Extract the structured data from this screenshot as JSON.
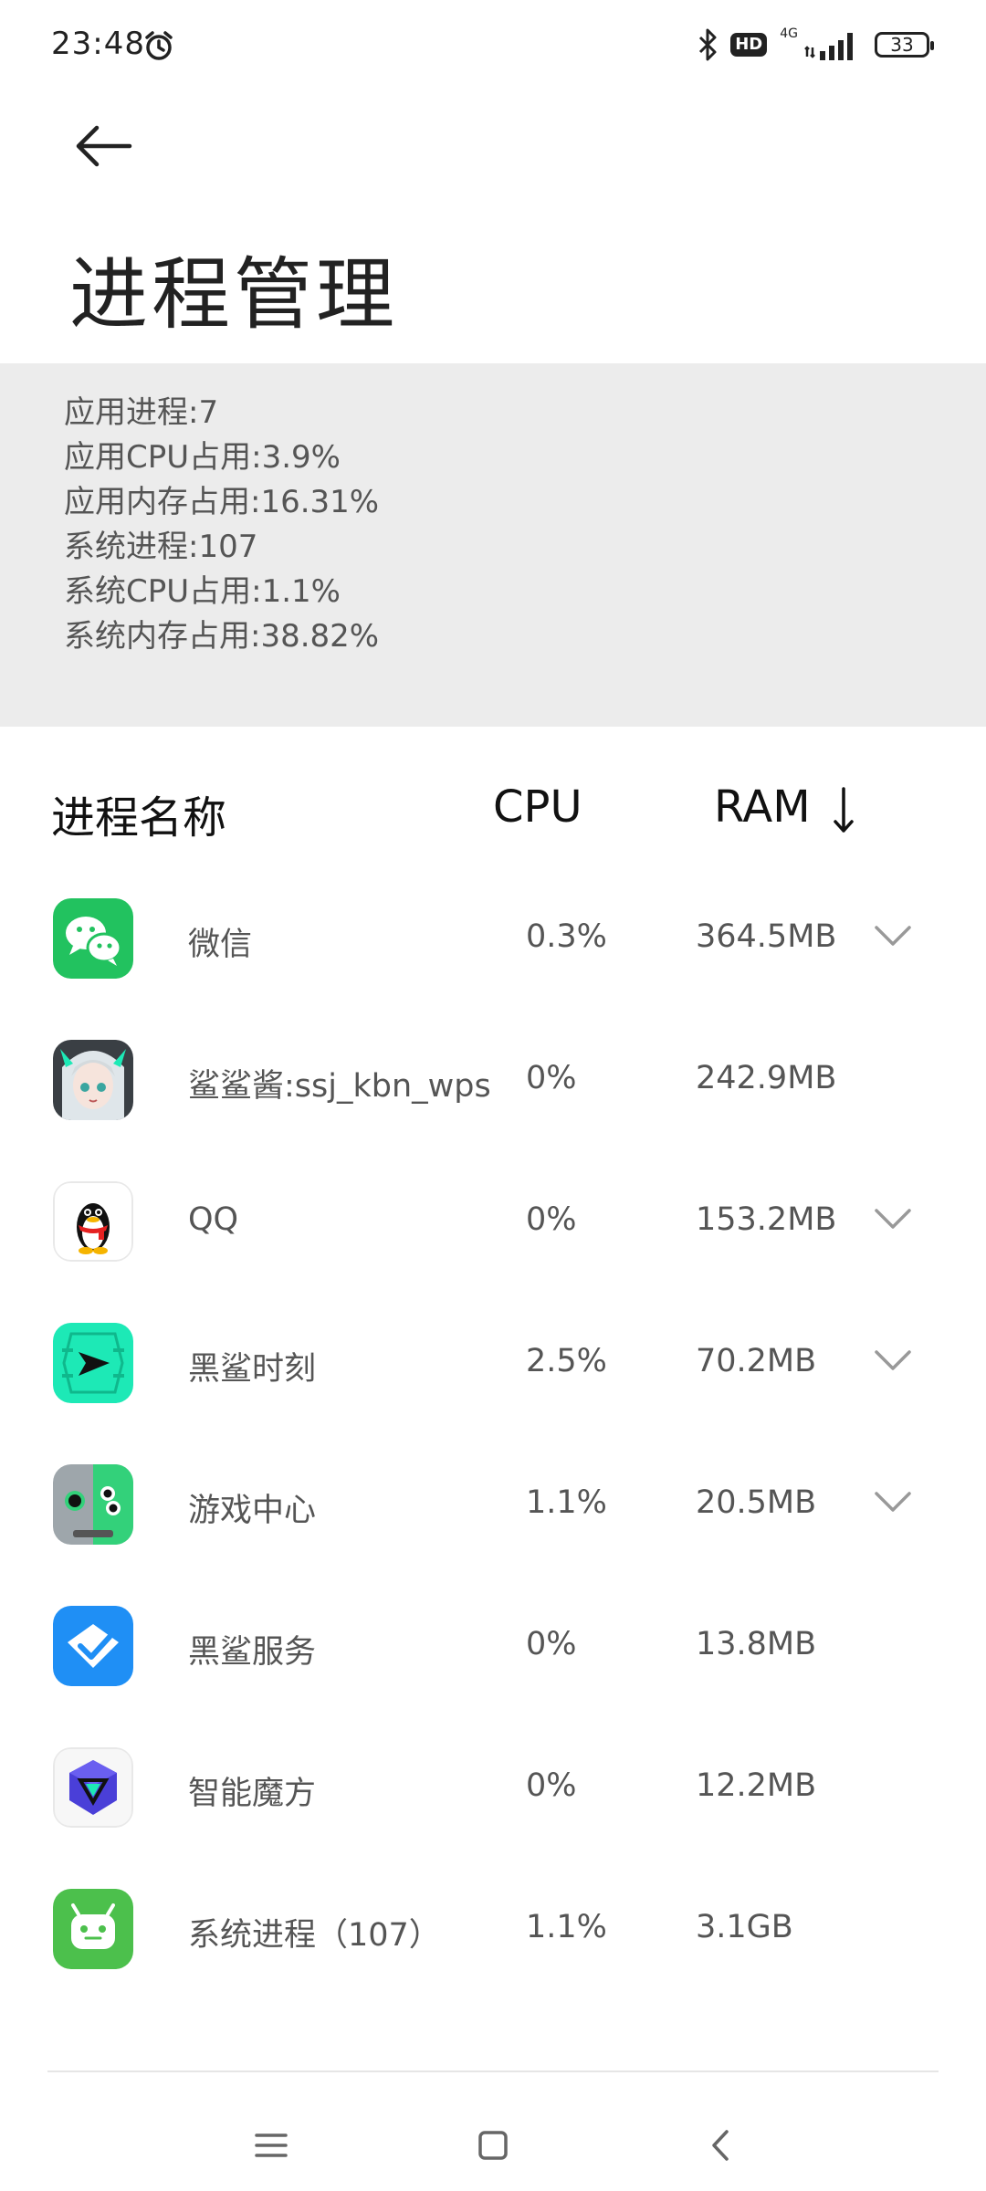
{
  "status_bar": {
    "time": "23:48",
    "network": "4G",
    "hd_badge": "HD",
    "battery": "33"
  },
  "header": {
    "title": "进程管理"
  },
  "summary": {
    "lines": [
      "应用进程:7",
      "应用CPU占用:3.9%",
      "应用内存占用:16.31%",
      "系统进程:107",
      "系统CPU占用:1.1%",
      "系统内存占用:38.82%"
    ]
  },
  "table": {
    "col_name": "进程名称",
    "col_cpu": "CPU",
    "col_ram": "RAM",
    "sort": "ram-descending",
    "rows": [
      {
        "name": "微信",
        "cpu": "0.3%",
        "ram": "364.5MB",
        "icon": "wechat-icon",
        "expandable": true
      },
      {
        "name": "鲨鲨酱:ssj_kbn_wps",
        "cpu": "0%",
        "ram": "242.9MB",
        "icon": "anime-avatar-icon",
        "expandable": false
      },
      {
        "name": "QQ",
        "cpu": "0%",
        "ram": "153.2MB",
        "icon": "qq-penguin-icon",
        "expandable": true
      },
      {
        "name": "黑鲨时刻",
        "cpu": "2.5%",
        "ram": "70.2MB",
        "icon": "blackshark-moment-icon",
        "expandable": true
      },
      {
        "name": "游戏中心",
        "cpu": "1.1%",
        "ram": "20.5MB",
        "icon": "game-center-icon",
        "expandable": true
      },
      {
        "name": "黑鲨服务",
        "cpu": "0%",
        "ram": "13.8MB",
        "icon": "blackshark-service-icon",
        "expandable": false
      },
      {
        "name": "智能魔方",
        "cpu": "0%",
        "ram": "12.2MB",
        "icon": "smart-cube-icon",
        "expandable": false
      },
      {
        "name": "系统进程（107）",
        "cpu": "1.1%",
        "ram": "3.1GB",
        "icon": "android-system-icon",
        "expandable": false
      }
    ]
  },
  "colors": {
    "summary_bg": "#ececec",
    "wechat_green": "#22c25f",
    "shark_teal": "#1de9b6",
    "service_blue": "#1f8ff5",
    "android_green": "#4cc04c"
  }
}
